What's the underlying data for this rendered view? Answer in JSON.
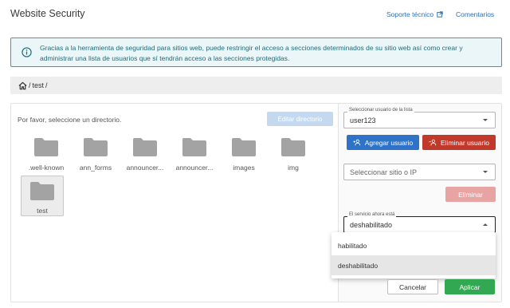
{
  "header": {
    "title": "Website Security",
    "support_label": "Soporte técnico",
    "support_icon": "external-link-icon",
    "comments_label": "Comentarios"
  },
  "info": {
    "icon": "info-icon",
    "text": "Gracias a la herramienta de seguridad para sitios web, puede restringir el acceso a secciones determinados de su sitio web así como crear y administrar una lista de usuarios que sí tendrán acceso a las secciones protegidas."
  },
  "breadcrumb": {
    "home_icon": "home-icon",
    "sep1": "/",
    "current": "test",
    "sep2": "/"
  },
  "directories": {
    "prompt": "Por favor, seleccione un directorio.",
    "edit_button": "Editar directorio",
    "folders": [
      {
        "name": ".well-known"
      },
      {
        "name": "ann_forms"
      },
      {
        "name": "announcer..."
      },
      {
        "name": "announcer..."
      },
      {
        "name": "images"
      },
      {
        "name": "img"
      },
      {
        "name": "test",
        "selected": true
      }
    ]
  },
  "users": {
    "select_label": "Seleccionar usuario de la lista",
    "selected_user": "user123",
    "add_button": "Agregar usuario",
    "remove_button": "Eliminar usuario"
  },
  "site": {
    "placeholder": "Seleccionar sitio o IP",
    "delete_button": "Eliminar"
  },
  "service": {
    "label": "El servicio ahora está",
    "value": "deshabilitado",
    "options": [
      "habilitado",
      "deshabilitado"
    ],
    "highlighted_option": "deshabilitado"
  },
  "footer": {
    "cancel_button": "Cancelar",
    "apply_button": "Aplicar"
  },
  "colors": {
    "accent_blue": "#2f73c9",
    "danger_red": "#c0392b",
    "success_green": "#33a852",
    "info_border": "#2fa3b6"
  }
}
